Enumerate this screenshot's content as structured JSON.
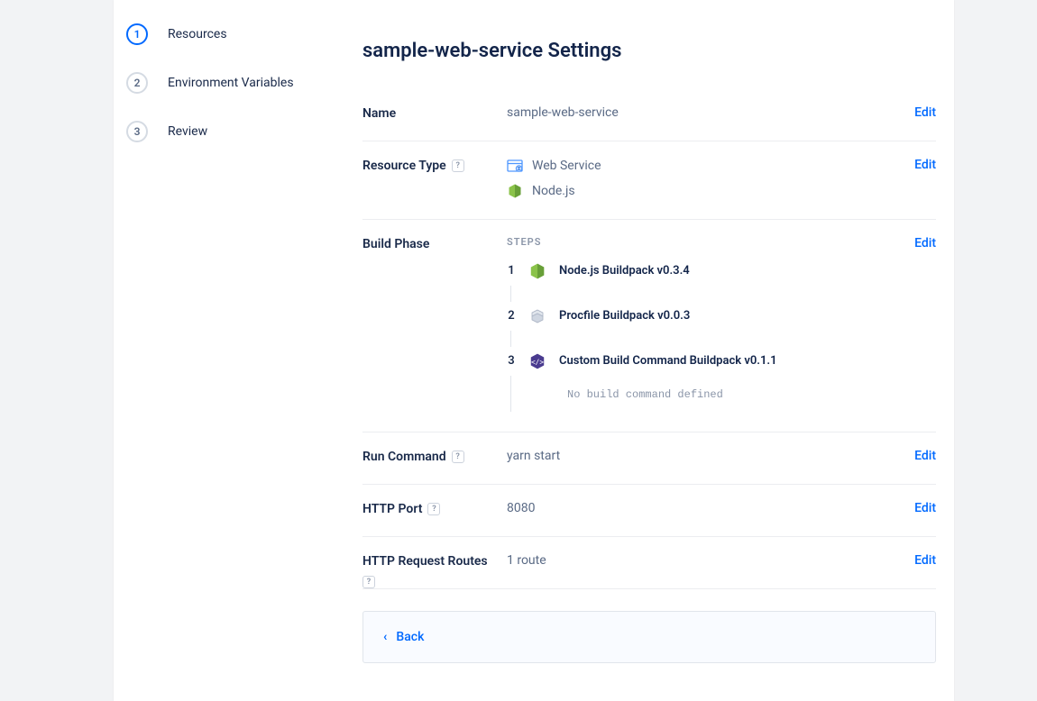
{
  "sidebar": {
    "items": [
      {
        "num": "1",
        "label": "Resources",
        "active": true
      },
      {
        "num": "2",
        "label": "Environment Variables",
        "active": false
      },
      {
        "num": "3",
        "label": "Review",
        "active": false
      }
    ]
  },
  "page": {
    "title": "sample-web-service Settings"
  },
  "name_section": {
    "label": "Name",
    "value": "sample-web-service",
    "edit": "Edit"
  },
  "resource_type_section": {
    "label": "Resource Type",
    "edit": "Edit",
    "rows": [
      {
        "label": "Web Service"
      },
      {
        "label": "Node.js"
      }
    ]
  },
  "build_phase_section": {
    "label": "Build Phase",
    "steps_heading": "STEPS",
    "edit": "Edit",
    "steps": [
      {
        "num": "1",
        "label": "Node.js Buildpack v0.3.4"
      },
      {
        "num": "2",
        "label": "Procfile Buildpack v0.0.3"
      },
      {
        "num": "3",
        "label": "Custom Build Command Buildpack v0.1.1"
      }
    ],
    "no_cmd": "No build command defined"
  },
  "run_command_section": {
    "label": "Run Command",
    "value": "yarn start",
    "edit": "Edit"
  },
  "http_port_section": {
    "label": "HTTP Port",
    "value": "8080",
    "edit": "Edit"
  },
  "http_routes_section": {
    "label": "HTTP Request Routes",
    "value": "1 route",
    "edit": "Edit"
  },
  "back": {
    "label": "Back"
  }
}
